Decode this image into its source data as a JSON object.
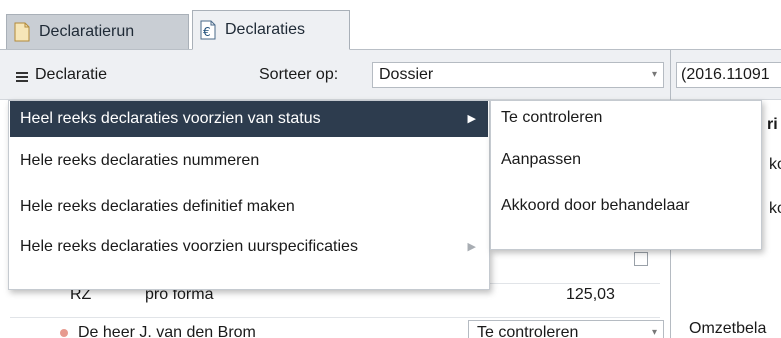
{
  "tabs": [
    {
      "label": "Declaratierun",
      "icon": "document-icon"
    },
    {
      "label": "Declaraties",
      "icon": "euro-document-icon"
    }
  ],
  "toolbar": {
    "title": "Declaratie",
    "sort_label": "Sorteer op:",
    "sort_value": "Dossier",
    "right_field_value": "(2016.11091"
  },
  "context_menu": {
    "items": [
      {
        "label": "Heel reeks declaraties voorzien van status",
        "has_submenu": true
      },
      {
        "label": "Hele reeks declaraties nummeren",
        "has_submenu": false
      },
      {
        "label": "Hele reeks declaraties definitief maken",
        "has_submenu": false
      },
      {
        "label": "Hele reeks declaraties voorzien uurspecificaties",
        "has_submenu": true
      }
    ]
  },
  "status_submenu": {
    "items": [
      "Te controleren",
      "Aanpassen",
      "Akkoord door behandelaar"
    ]
  },
  "list": {
    "rows": [
      {
        "code": "RZ",
        "type": "pro forma",
        "amount": "125,03"
      },
      {
        "name": "De heer J. van den Brom",
        "status": "Te controleren"
      }
    ]
  },
  "right_panel": {
    "fragments": [
      "ri",
      "ko",
      "ko",
      "Omzetbela"
    ]
  },
  "colors": {
    "menu_highlight": "#2d3c4e",
    "toolbar_bg": "#eef0f3",
    "status_dot": "#e79a8f"
  }
}
